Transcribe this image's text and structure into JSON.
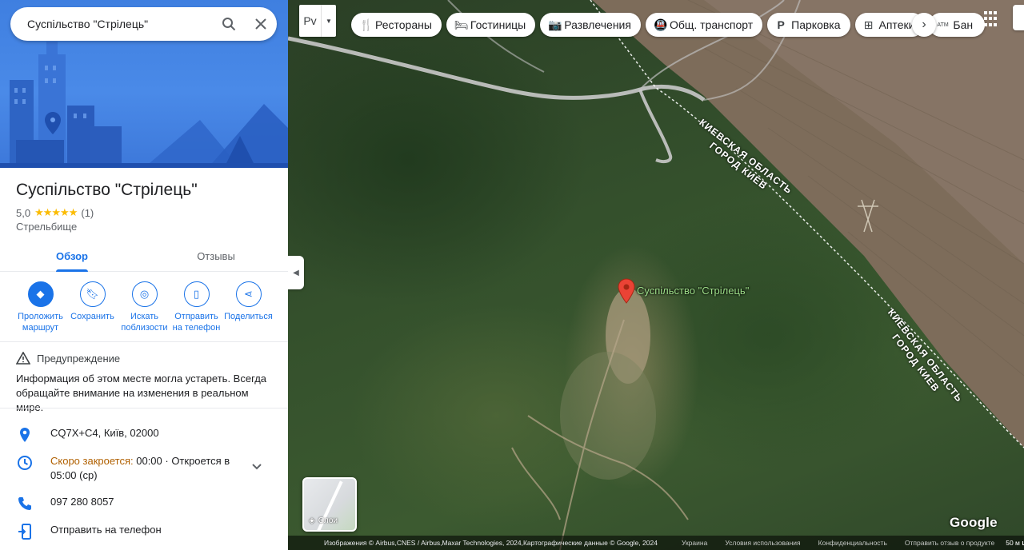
{
  "search": {
    "value": "Суспільство \"Стрілець\""
  },
  "place": {
    "title": "Суспільство \"Стрілець\"",
    "rating": "5,0",
    "stars": "★★★★★",
    "review_count": "(1)",
    "category": "Стрельбище"
  },
  "tabs": [
    {
      "label": "Обзор",
      "active": true
    },
    {
      "label": "Отзывы",
      "active": false
    }
  ],
  "actions": [
    {
      "label_1": "Проложить",
      "label_2": "маршрут",
      "icon": "directions-icon"
    },
    {
      "label_1": "Сохранить",
      "label_2": "",
      "icon": "bookmark-icon"
    },
    {
      "label_1": "Искать",
      "label_2": "поблизости",
      "icon": "nearby-icon"
    },
    {
      "label_1": "Отправить",
      "label_2": "на телефон",
      "icon": "send-to-phone-icon"
    },
    {
      "label_1": "Поделиться",
      "label_2": "",
      "icon": "share-icon"
    }
  ],
  "warning": {
    "title": "Предупреждение",
    "body": "Информация об этом месте могла устареть. Всегда обращайте внимание на изменения в реальном мире."
  },
  "details": {
    "address": "CQ7X+C4, Київ, 02000",
    "hours_status": "Скоро закроется:",
    "hours_rest": " 00:00 · Откроется в 05:00 (ср)",
    "phone": "097 280 8057",
    "send": "Отправить на телефон"
  },
  "map": {
    "rv_label": "Рv",
    "chips": [
      {
        "label": "Рестораны",
        "icon": "restaurant-icon"
      },
      {
        "label": "Гостиницы",
        "icon": "hotel-icon"
      },
      {
        "label": "Развлечения",
        "icon": "camera-icon"
      },
      {
        "label": "Общ. транспорт",
        "icon": "transit-icon"
      },
      {
        "label": "Парковка",
        "icon": "parking-icon"
      },
      {
        "label": "Аптеки",
        "icon": "pharmacy-icon"
      },
      {
        "label": "Бан",
        "icon": "atm-icon"
      }
    ],
    "pin_label": "Суспільство \"Стрілець\"",
    "region_label_1a": "КИЕВСКАЯ ОБЛАСТЬ",
    "region_label_1b": "ГОРОД КИЕВ",
    "region_label_2a": "КИЕВСКАЯ ОБЛАСТЬ",
    "region_label_2b": "ГОРОД КИЕВ",
    "layers_label": "Слои",
    "google": "Google",
    "attribution": "Изображения © Airbus,CNES / Airbus,Maxar Technologies, 2024,Картографические данные © Google, 2024",
    "links": [
      "Украина",
      "Условия использования",
      "Конфиденциальность",
      "Отправить отзыв о продукте"
    ],
    "scale": "50 м"
  }
}
